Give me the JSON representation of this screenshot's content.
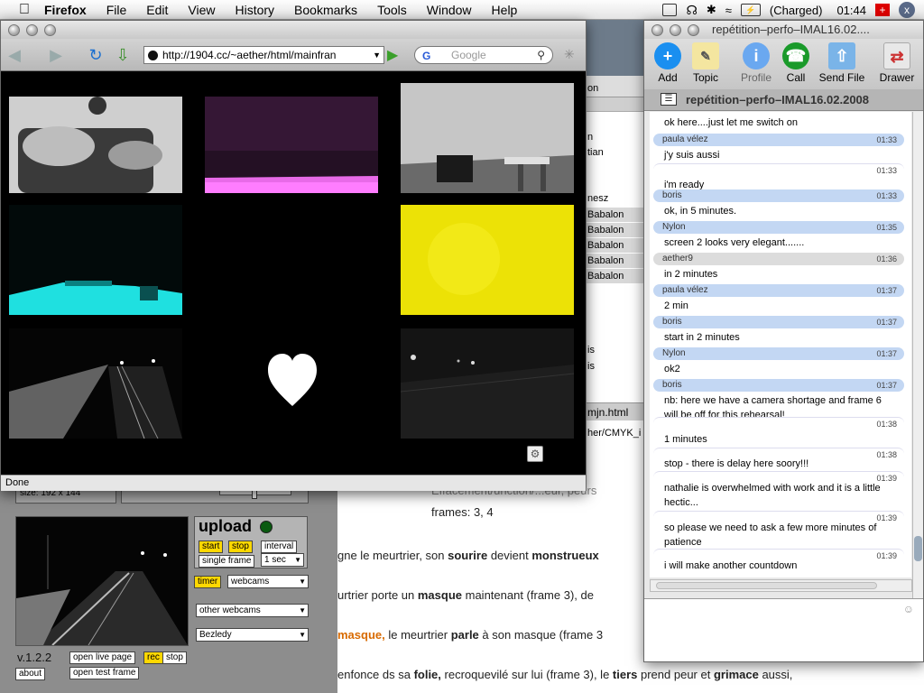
{
  "menubar": {
    "app": "Firefox",
    "items": [
      "File",
      "Edit",
      "View",
      "History",
      "Bookmarks",
      "Tools",
      "Window",
      "Help"
    ],
    "battery": "(Charged)",
    "clock": "01:44"
  },
  "browser": {
    "url": "http://1904.cc/~aether/html/mainfran",
    "search_placeholder": "Google",
    "status": "Done"
  },
  "background_list": {
    "rows": [
      {
        "text": "on",
        "selected": false
      },
      {
        "text": "n",
        "selected": false
      },
      {
        "text": "tian",
        "selected": false
      },
      {
        "text": "nesz",
        "selected": false
      },
      {
        "text": "Babalon",
        "selected": true
      },
      {
        "text": "Babalon",
        "selected": true
      },
      {
        "text": "Babalon",
        "selected": true
      },
      {
        "text": "Babalon",
        "selected": true
      },
      {
        "text": "Babalon",
        "selected": true
      },
      {
        "text": "is",
        "selected": false
      },
      {
        "text": "is",
        "selected": false
      }
    ],
    "file1": "mjn.html",
    "file2": "her/CMYK_i"
  },
  "document": {
    "line0a": "Effacement/unction/...eur, peurs",
    "line0b": "frames: 3, 4",
    "line1a": "gne le meurtrier, son ",
    "line1b": "sourire",
    "line1c": " devient ",
    "line1d": "monstrueux",
    "line2a": "urtrier porte un ",
    "line2b": "masque",
    "line2c": " maintenant (frame 3), de",
    "line3a": "masque,",
    "line3b": " le meurtrier ",
    "line3c": "parle",
    "line3d": " à son masque (frame 3",
    "line4a": "enfonce ds sa ",
    "line4b": "folie,",
    "line4c": " recroquevilé sur lui (frame 3), le ",
    "line4d": "tiers",
    "line4e": " prend peur et ",
    "line4f": "grimace",
    "line4g": " aussi,"
  },
  "uploader": {
    "size_label": "size:  192 x 144",
    "title": "upload",
    "start": "start",
    "stop": "stop",
    "interval": "interval",
    "single_frame": "single frame",
    "interval_value": "1 sec",
    "timer": "timer",
    "webcams": "webcams",
    "other_webcams": "other webcams",
    "bezledy": "Bezledy",
    "version": "v.1.2.2",
    "about": "about",
    "open_live": "open live page",
    "rec": "rec",
    "stop2": "stop",
    "open_test": "open test frame"
  },
  "chat": {
    "window_title": "repétition–perfo–IMAL16.02....",
    "room": "repétition–perfo–IMAL16.02.2008",
    "toolbar": [
      {
        "label": "Add",
        "icon": "add-icon"
      },
      {
        "label": "Topic",
        "icon": "topic-icon"
      },
      {
        "label": "Profile",
        "icon": "profile-icon"
      },
      {
        "label": "Call",
        "icon": "call-icon"
      },
      {
        "label": "Send File",
        "icon": "send-file-icon"
      },
      {
        "label": "Drawer",
        "icon": "drawer-icon"
      }
    ],
    "messages": [
      {
        "sender": "",
        "time": "",
        "text": "ok here....just let me switch on",
        "style": "none"
      },
      {
        "sender": "paula vélez",
        "time": "01:33",
        "text": "j'y suis aussi",
        "style": "blue"
      },
      {
        "sender": "",
        "time": "01:33",
        "text": "i'm ready",
        "style": "light"
      },
      {
        "sender": "boris",
        "time": "01:33",
        "text": "ok, in 5 minutes.",
        "style": "blue"
      },
      {
        "sender": "Nylon",
        "time": "01:35",
        "text": "screen 2 looks very elegant.......",
        "style": "blue"
      },
      {
        "sender": "aether9",
        "time": "01:36",
        "text": "in 2 minutes",
        "style": "gray"
      },
      {
        "sender": "paula vélez",
        "time": "01:37",
        "text": "2 min",
        "style": "blue"
      },
      {
        "sender": "boris",
        "time": "01:37",
        "text": "start in 2 minutes",
        "style": "blue"
      },
      {
        "sender": "Nylon",
        "time": "01:37",
        "text": "ok2",
        "style": "blue"
      },
      {
        "sender": "boris",
        "time": "01:37",
        "text": "nb: here we have a camera shortage and frame 6 will be off for this rehearsal!",
        "style": "blue"
      },
      {
        "sender": "",
        "time": "01:38",
        "text": "1 minutes",
        "style": "light"
      },
      {
        "sender": "",
        "time": "01:38",
        "text": "stop - there is delay here soory!!!",
        "style": "light"
      },
      {
        "sender": "",
        "time": "01:39",
        "text": "nathalie is overwhelmed with work and it is a little hectic...",
        "style": "light"
      },
      {
        "sender": "",
        "time": "01:39",
        "text": "so please we need to ask a few more minutes of patience",
        "style": "light"
      },
      {
        "sender": "",
        "time": "01:39",
        "text": "i will make another countdown",
        "style": "light"
      }
    ]
  },
  "colors": {
    "chat_header_blue": "#c3d7f3",
    "chat_header_gray": "#dcdcdc",
    "upload_yellow": "#ffd800",
    "doc_orange": "#d86a00"
  }
}
